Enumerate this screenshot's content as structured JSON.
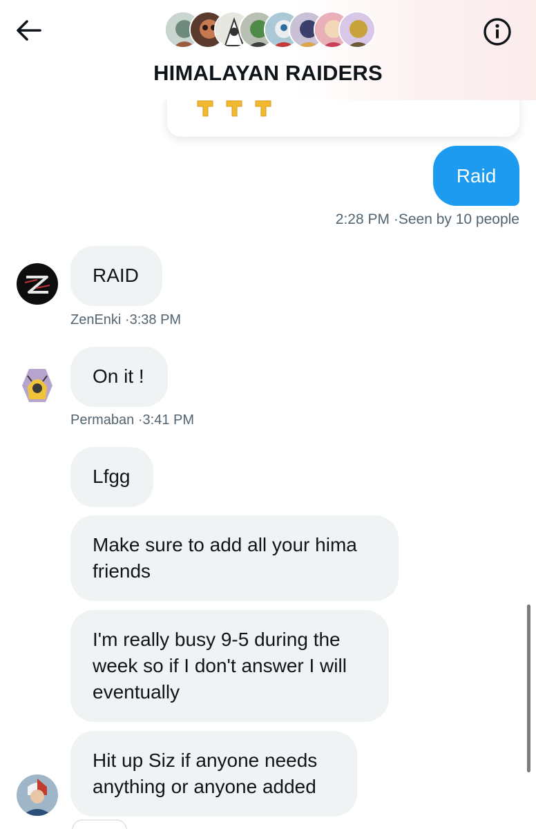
{
  "header": {
    "title": "HIMALAYAN RAIDERS",
    "back_icon": "arrow-left-icon",
    "info_icon": "info-icon",
    "member_avatar_count": 8
  },
  "messages": {
    "outgoing": {
      "text": "Raid",
      "time": "2:28 PM",
      "seen": "Seen by 10 people",
      "color": "#1d9bf0"
    },
    "zenenki": {
      "text": "RAID",
      "sender": "ZenEnki",
      "time": "3:38 PM"
    },
    "permaban": {
      "text": "On it !",
      "sender": "Permaban",
      "time": "3:41 PM"
    },
    "group": [
      {
        "text": "Lfgg"
      },
      {
        "text": "Make sure to add all your hima friends"
      },
      {
        "text": "I'm really busy 9-5 during the week so if I don't answer I will eventually"
      },
      {
        "text": "Hit up Siz if anyone needs anything or anyone added"
      }
    ]
  },
  "colors": {
    "bubble_in": "#eff3f4",
    "meta_text": "#536471",
    "text": "#0f1419"
  }
}
